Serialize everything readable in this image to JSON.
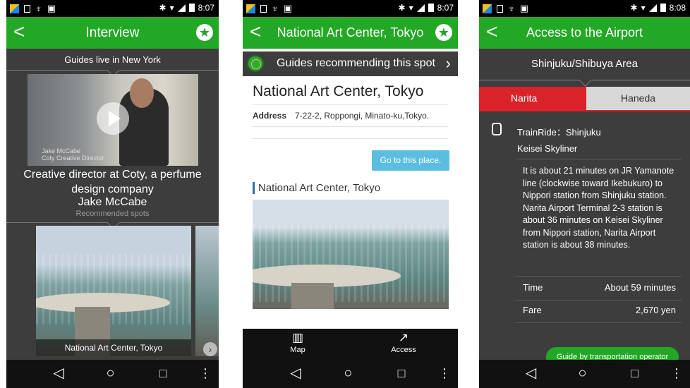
{
  "status": {
    "time1": "8:07",
    "time2": "8:07",
    "time3": "8:08"
  },
  "icons": {
    "back": "chevron-left-icon",
    "favorite": "star-icon",
    "nav_back": "triangle-back-icon",
    "nav_home": "circle-home-icon",
    "nav_recent": "square-recent-icon",
    "nav_menu": "dots-menu-icon"
  },
  "colors": {
    "header_green": "#23a825",
    "narita_red": "#d9222a",
    "go_button_blue": "#5bbde0"
  },
  "screen1": {
    "title": "Interview",
    "guides_header": "Guides live in New York",
    "video_caption_name": "Jake McCabe",
    "video_caption_role": "Coty Creative Director",
    "guide_description": "Creative director at Coty, a perfume design company",
    "guide_name": "Jake McCabe",
    "recommended_header": "Recommended spots",
    "spot_label": "National Art Center, Tokyo"
  },
  "screen2": {
    "title": "National Art Center, Tokyo",
    "recommend_bar": "Guides recommending this spot",
    "place_title": "National Art Center, Tokyo",
    "address_label": "Address",
    "address_value": "7-22-2, Roppongi, Minato-ku,Tokyo.",
    "go_button": "Go to this place.",
    "section_title": "National Art Center, Tokyo",
    "tabs": [
      {
        "label": "Map",
        "icon": "map-icon"
      },
      {
        "label": "Access",
        "icon": "route-arrow-icon"
      }
    ]
  },
  "screen3": {
    "title": "Access to the Airport",
    "area": "Shinjuku/Shibuya Area",
    "tab_narita": "Narita",
    "tab_haneda": "Haneda",
    "ride": "TrainRide：Shinjuku",
    "line": "Keisei Skyliner",
    "description_1": "It is about 21 minutes on JR Yamanote line (clockwise toward Ikebukuro) to Nippori station from Shinjuku station.",
    "description_2": "Narita Airport Terminal 2-3 station is about 36 minutes on Keisei Skyliner from Nippori station, Narita Airport station is about 38 minutes.",
    "time_label": "Time",
    "time_value": "About 59 minutes",
    "fare_label": "Fare",
    "fare_value": "2,670 yen",
    "operator_button": "Guide by transportation operator"
  }
}
